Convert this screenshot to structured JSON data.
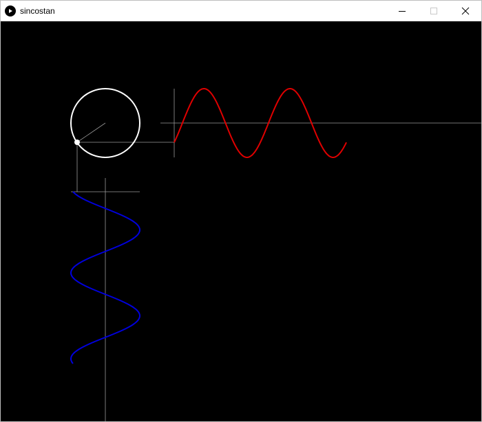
{
  "window": {
    "title": "sincostan",
    "app_icon": "play-icon",
    "controls": [
      "minimize-icon",
      "maximize-icon",
      "close-icon"
    ]
  },
  "canvas": {
    "background": "#000000",
    "colors": {
      "circle": "#ffffff",
      "guides": "#9a9a9a",
      "sine_wave": "#e00000",
      "cosine_wave": "#0000dd",
      "point": "#ffffff"
    },
    "waves": {
      "sine": {
        "cycles": 2
      },
      "cosine": {
        "cycles": 2
      }
    }
  }
}
